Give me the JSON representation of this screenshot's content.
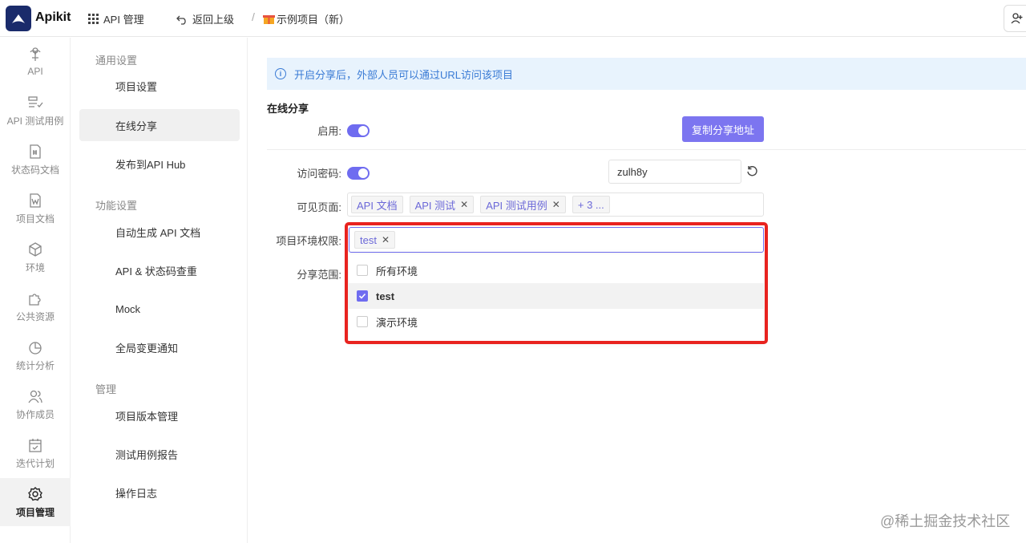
{
  "app": {
    "name": "Apikit"
  },
  "topbar": {
    "api_manage_label": "API 管理",
    "back_label": "返回上级",
    "separator": "/",
    "project_name": "示例项目（新）"
  },
  "leftnav": {
    "items": [
      {
        "label": "API",
        "icon": "api-icon"
      },
      {
        "label": "API 测试用例",
        "icon": "test-case-icon"
      },
      {
        "label": "状态码文档",
        "icon": "status-doc-icon"
      },
      {
        "label": "项目文档",
        "icon": "project-doc-icon"
      },
      {
        "label": "环境",
        "icon": "environment-icon"
      },
      {
        "label": "公共资源",
        "icon": "puzzle-icon"
      },
      {
        "label": "统计分析",
        "icon": "pie-chart-icon"
      },
      {
        "label": "协作成员",
        "icon": "members-icon"
      },
      {
        "label": "迭代计划",
        "icon": "calendar-icon"
      },
      {
        "label": "项目管理",
        "icon": "gear-icon",
        "active": true
      }
    ]
  },
  "subnav": {
    "group1": "通用设置",
    "item_project_settings": "项目设置",
    "item_online_share": "在线分享",
    "item_publish": "发布到API Hub",
    "group2": "功能设置",
    "item_auto_doc": "自动生成 API 文档",
    "item_dedupe": "API & 状态码查重",
    "item_mock": "Mock",
    "item_notify": "全局变更通知",
    "group3": "管理",
    "item_version": "项目版本管理",
    "item_report": "测试用例报告",
    "item_log": "操作日志"
  },
  "main": {
    "info": "开启分享后，外部人员可以通过URL访问该项目",
    "section_title": "在线分享",
    "enable_label": "启用:",
    "enable_on": true,
    "copy_button": "复制分享地址",
    "password_label": "访问密码:",
    "password_on": true,
    "password_value": "zulh8y",
    "visible_pages_label": "可见页面:",
    "visible_tags": [
      "API 文档",
      "API 测试",
      "API 测试用例"
    ],
    "more_tag": "+ 3 ...",
    "env_label": "项目环境权限:",
    "env_selected_tag": "test",
    "scope_label": "分享范围:",
    "env_options": [
      {
        "label": "所有环境",
        "checked": false
      },
      {
        "label": "test",
        "checked": true
      },
      {
        "label": "演示环境",
        "checked": false
      }
    ]
  },
  "watermark": "@稀土掘金技术社区",
  "colors": {
    "accent": "#6f6cf0",
    "highlight_box": "#e8231f",
    "info_bg": "#e8f3fd",
    "brand": "#1a2b6b"
  }
}
